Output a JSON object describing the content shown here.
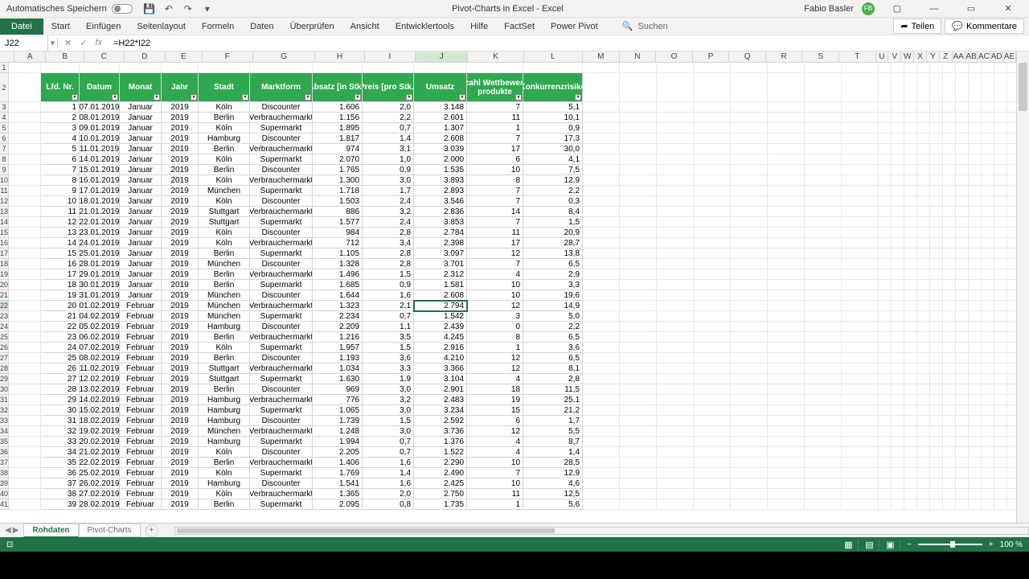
{
  "titlebar": {
    "autosave": "Automatisches Speichern",
    "doc_title": "Pivot-Charts in Excel  -  Excel",
    "user": "Fabio Basler",
    "user_initials": "FB"
  },
  "ribbon": {
    "file": "Datei",
    "tabs": [
      "Start",
      "Einfügen",
      "Seitenlayout",
      "Formeln",
      "Daten",
      "Überprüfen",
      "Ansicht",
      "Entwicklertools",
      "Hilfe",
      "FactSet",
      "Power Pivot"
    ],
    "search": "Suchen",
    "share": "Teilen",
    "comments": "Kommentare"
  },
  "formula": {
    "name": "J22",
    "value": "=H22*I22"
  },
  "columns": {
    "letters": [
      "A",
      "B",
      "C",
      "D",
      "E",
      "F",
      "G",
      "H",
      "I",
      "J",
      "K",
      "L",
      "M",
      "N",
      "O",
      "P",
      "Q",
      "R",
      "S",
      "T",
      "U",
      "V",
      "W",
      "X",
      "Y",
      "Z",
      "AA",
      "AB",
      "AC",
      "AD",
      "AE"
    ]
  },
  "headers": [
    "Lfd. Nr.",
    "Datum",
    "Monat",
    "Jahr",
    "Stadt",
    "Marktform",
    "Absatz [in Stk.]",
    "Preis [pro Stk.]",
    "Umsatz",
    "Anzahl Wettbewerbs-produkte",
    "Konkurrenzrisiko"
  ],
  "rows": [
    [
      "1",
      "07.01.2019",
      "Januar",
      "2019",
      "Köln",
      "Discounter",
      "1.606",
      "2,0",
      "3.148",
      "7",
      "5,1"
    ],
    [
      "2",
      "08.01.2019",
      "Januar",
      "2019",
      "Berlin",
      "Verbrauchermarkt",
      "1.156",
      "2,2",
      "2.601",
      "11",
      "10,1"
    ],
    [
      "3",
      "09.01.2019",
      "Januar",
      "2019",
      "Köln",
      "Supermarkt",
      "1.895",
      "0,7",
      "1.307",
      "1",
      "0,9"
    ],
    [
      "4",
      "10.01.2019",
      "Januar",
      "2019",
      "Hamburg",
      "Discounter",
      "1.817",
      "1,4",
      "2.608",
      "7",
      "17,3"
    ],
    [
      "5",
      "11.01.2019",
      "Januar",
      "2019",
      "Berlin",
      "Verbrauchermarkt",
      "974",
      "3,1",
      "3.039",
      "17",
      "30,0"
    ],
    [
      "6",
      "14.01.2019",
      "Januar",
      "2019",
      "Köln",
      "Supermarkt",
      "2.070",
      "1,0",
      "2.000",
      "6",
      "4,1"
    ],
    [
      "7",
      "15.01.2019",
      "Januar",
      "2019",
      "Berlin",
      "Discounter",
      "1.765",
      "0,9",
      "1.535",
      "10",
      "7,5"
    ],
    [
      "8",
      "16.01.2019",
      "Januar",
      "2019",
      "Köln",
      "Verbrauchermarkt",
      "1.300",
      "3,0",
      "3.893",
      "8",
      "12,9"
    ],
    [
      "9",
      "17.01.2019",
      "Januar",
      "2019",
      "München",
      "Supermarkt",
      "1.718",
      "1,7",
      "2.893",
      "7",
      "2,2"
    ],
    [
      "10",
      "18.01.2019",
      "Januar",
      "2019",
      "Köln",
      "Discounter",
      "1.503",
      "2,4",
      "3.546",
      "7",
      "0,3"
    ],
    [
      "11",
      "21.01.2019",
      "Januar",
      "2019",
      "Stuttgart",
      "Verbrauchermarkt",
      "886",
      "3,2",
      "2.836",
      "14",
      "8,4"
    ],
    [
      "12",
      "22.01.2019",
      "Januar",
      "2019",
      "Stuttgart",
      "Supermarkt",
      "1.577",
      "2,4",
      "3.853",
      "7",
      "1,5"
    ],
    [
      "13",
      "23.01.2019",
      "Januar",
      "2019",
      "Köln",
      "Discounter",
      "984",
      "2,8",
      "2.784",
      "11",
      "20,9"
    ],
    [
      "14",
      "24.01.2019",
      "Januar",
      "2019",
      "Köln",
      "Verbrauchermarkt",
      "712",
      "3,4",
      "2.398",
      "17",
      "28,7"
    ],
    [
      "15",
      "25.01.2019",
      "Januar",
      "2019",
      "Berlin",
      "Supermarkt",
      "1.105",
      "2,8",
      "3.097",
      "12",
      "13,8"
    ],
    [
      "16",
      "28.01.2019",
      "Januar",
      "2019",
      "München",
      "Discounter",
      "1.328",
      "2,8",
      "3.701",
      "7",
      "6,5"
    ],
    [
      "17",
      "29.01.2019",
      "Januar",
      "2019",
      "Berlin",
      "Verbrauchermarkt",
      "1.496",
      "1,5",
      "2.312",
      "4",
      "2,9"
    ],
    [
      "18",
      "30.01.2019",
      "Januar",
      "2019",
      "Berlin",
      "Supermarkt",
      "1.685",
      "0,9",
      "1.581",
      "10",
      "3,3"
    ],
    [
      "19",
      "31.01.2019",
      "Januar",
      "2019",
      "München",
      "Discounter",
      "1.644",
      "1,6",
      "2.608",
      "10",
      "19,6"
    ],
    [
      "20",
      "01.02.2019",
      "Februar",
      "2019",
      "München",
      "Verbrauchermarkt",
      "1.323",
      "2,1",
      "2.794",
      "12",
      "14,9"
    ],
    [
      "21",
      "04.02.2019",
      "Februar",
      "2019",
      "München",
      "Supermarkt",
      "2.234",
      "0,7",
      "1.542",
      "3",
      "5,0"
    ],
    [
      "22",
      "05.02.2019",
      "Februar",
      "2019",
      "Hamburg",
      "Discounter",
      "2.209",
      "1,1",
      "2.439",
      "0",
      "2,2"
    ],
    [
      "23",
      "06.02.2019",
      "Februar",
      "2019",
      "Berlin",
      "Verbrauchermarkt",
      "1.216",
      "3,5",
      "4.245",
      "8",
      "6,5"
    ],
    [
      "24",
      "07.02.2019",
      "Februar",
      "2019",
      "Köln",
      "Supermarkt",
      "1.957",
      "1,5",
      "2.916",
      "1",
      "3,6"
    ],
    [
      "25",
      "08.02.2019",
      "Februar",
      "2019",
      "Berlin",
      "Discounter",
      "1.193",
      "3,6",
      "4.210",
      "12",
      "6,5"
    ],
    [
      "26",
      "11.02.2019",
      "Februar",
      "2019",
      "Stuttgart",
      "Verbrauchermarkt",
      "1.034",
      "3,3",
      "3.366",
      "12",
      "8,1"
    ],
    [
      "27",
      "12.02.2019",
      "Februar",
      "2019",
      "Stuttgart",
      "Supermarkt",
      "1.630",
      "1,9",
      "3.104",
      "4",
      "2,8"
    ],
    [
      "28",
      "13.02.2019",
      "Februar",
      "2019",
      "Berlin",
      "Discounter",
      "969",
      "3,0",
      "2.901",
      "18",
      "11,5"
    ],
    [
      "29",
      "14.02.2019",
      "Februar",
      "2019",
      "Hamburg",
      "Verbrauchermarkt",
      "776",
      "3,2",
      "2.483",
      "19",
      "25,1"
    ],
    [
      "30",
      "15.02.2019",
      "Februar",
      "2019",
      "Hamburg",
      "Supermarkt",
      "1.065",
      "3,0",
      "3.234",
      "15",
      "21,2"
    ],
    [
      "31",
      "18.02.2019",
      "Februar",
      "2019",
      "Hamburg",
      "Discounter",
      "1.739",
      "1,5",
      "2.592",
      "6",
      "1,7"
    ],
    [
      "32",
      "19.02.2019",
      "Februar",
      "2019",
      "München",
      "Verbrauchermarkt",
      "1.248",
      "3,0",
      "3.736",
      "12",
      "5,5"
    ],
    [
      "33",
      "20.02.2019",
      "Februar",
      "2019",
      "Hamburg",
      "Supermarkt",
      "1.994",
      "0,7",
      "1.376",
      "4",
      "8,7"
    ],
    [
      "34",
      "21.02.2019",
      "Februar",
      "2019",
      "Köln",
      "Discounter",
      "2.205",
      "0,7",
      "1.522",
      "4",
      "1,4"
    ],
    [
      "35",
      "22.02.2019",
      "Februar",
      "2019",
      "Berlin",
      "Verbrauchermarkt",
      "1.406",
      "1,6",
      "2.290",
      "10",
      "28,5"
    ],
    [
      "36",
      "25.02.2019",
      "Februar",
      "2019",
      "Köln",
      "Supermarkt",
      "1.769",
      "1,4",
      "2.490",
      "7",
      "12,9"
    ],
    [
      "37",
      "26.02.2019",
      "Februar",
      "2019",
      "Hamburg",
      "Discounter",
      "1.541",
      "1,6",
      "2.425",
      "10",
      "4,6"
    ],
    [
      "38",
      "27.02.2019",
      "Februar",
      "2019",
      "Köln",
      "Verbrauchermarkt",
      "1.365",
      "2,0",
      "2.750",
      "11",
      "12,5"
    ],
    [
      "39",
      "28.02.2019",
      "Februar",
      "2019",
      "Berlin",
      "Supermarkt",
      "2.095",
      "0,8",
      "1.735",
      "1",
      "5,6"
    ]
  ],
  "selected": {
    "row": 22,
    "col": "J"
  },
  "sheets": {
    "active": "Rohdaten",
    "others": [
      "Pivot-Charts"
    ]
  },
  "status": {
    "zoom": "100 %"
  }
}
